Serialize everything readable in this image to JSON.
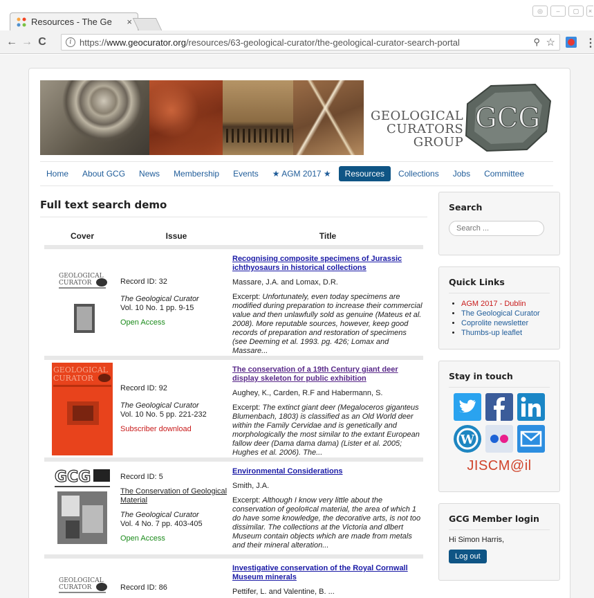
{
  "browser": {
    "tab_title": "Resources - The Ge",
    "url_scheme": "https://",
    "url_host": "www.geocurator.org",
    "url_path": "/resources/63-geological-curator/the-geological-curator-search-portal",
    "icons": {
      "back": "back-arrow-icon",
      "forward": "forward-arrow-icon",
      "reload": "reload-icon",
      "info": "info-icon",
      "zoom": "zoom-icon",
      "star": "bookmark-star-icon"
    }
  },
  "site": {
    "logo_lines": [
      "GEOLOGICAL",
      "CURATORS",
      "GROUP"
    ],
    "logo_mark": "GCG",
    "nav": [
      "Home",
      "About GCG",
      "News",
      "Membership",
      "Events",
      "★ AGM 2017 ★",
      "Resources",
      "Collections",
      "Jobs",
      "Committee"
    ],
    "nav_active": "Resources",
    "accent": "#0f5585"
  },
  "main": {
    "title": "Full text search demo",
    "headers": {
      "cover": "Cover",
      "issue": "Issue",
      "title": "Title"
    },
    "rows": [
      {
        "record": "Record ID: 32",
        "journal": "The Geological Curator",
        "vol": "Vol. 10 No. 1 pp. 9-15",
        "access": "Open Access",
        "title": "Recognising composite specimens of Jurassic ichthyosaurs in historical collections",
        "authors": "Massare, J.A. and Lomax, D.R.",
        "excerpt_label": "Excerpt: ",
        "excerpt": "Unfortunately, even today specimens are modified during preparation to increase their commercial value and then unlawfully sold as genuine (Mateus et al. 2008). More reputable sources, however, keep good records of preparation and restoration of specimens (see Deeming et al. 1993. pg. 426; Lomax and Massare..."
      },
      {
        "record": "Record ID: 92",
        "journal": "The Geological Curator",
        "vol": "Vol. 10 No. 5 pp. 221-232",
        "access": "Subscriber download",
        "title": "The conservation of a 19th Century giant deer display skeleton for public exhibition",
        "authors": "Aughey, K., Carden, R.F and Habermann, S.",
        "excerpt_label": "Excerpt: ",
        "excerpt": "The extinct giant deer (Megaloceros giganteus Blumenbach, 1803) is classified as an Old World deer within the Family Cervidae and is genetically and morphologically the most similar to the extant European fallow deer (Dama dama dama) (Lister et al. 2005; Hughes et al. 2006). The..."
      },
      {
        "record": "Record ID: 5",
        "book": "The Conservation of Geological Material",
        "journal": "The Geological Curator",
        "vol": "Vol. 4 No. 7 pp. 403-405",
        "access": "Open Access",
        "title": "Environmental Considerations",
        "authors": "Smith, J.A.",
        "excerpt_label": "Excerpt: ",
        "excerpt": "Although I know very little about the conservation of geolo#cal material, the area of which 1 do have some knowledge, the decorative arts, is not too dissimilar. The collections at the Victoria and dlbert Museum contain objects which are made from metals and their mineral alteration..."
      },
      {
        "record": "Record ID: 86",
        "title": "Investigative conservation of the Royal Cornwall Museum minerals",
        "authors": "Pettifer, L. and Valentine, B. ..."
      }
    ],
    "cover_text": {
      "geo": "GEOLOGICAL",
      "cur": "CURATOR",
      "gcg": "GCG",
      "the": "THE GEOLOGICAL CURATOR"
    }
  },
  "sidebar": {
    "search_title": "Search",
    "search_placeholder": "Search ...",
    "links_title": "Quick Links",
    "links": [
      "AGM 2017 - Dublin",
      "The Geological Curator",
      "Coprolite newsletter",
      "Thumbs-up leaflet"
    ],
    "touch_title": "Stay in touch",
    "social": [
      "twitter-icon",
      "facebook-icon",
      "linkedin-icon",
      "wordpress-icon",
      "flickr-icon",
      "email-icon"
    ],
    "jisc": "JISCM@il",
    "login_title": "GCG Member login",
    "greeting": "Hi Simon Harris,",
    "logout": "Log out"
  }
}
